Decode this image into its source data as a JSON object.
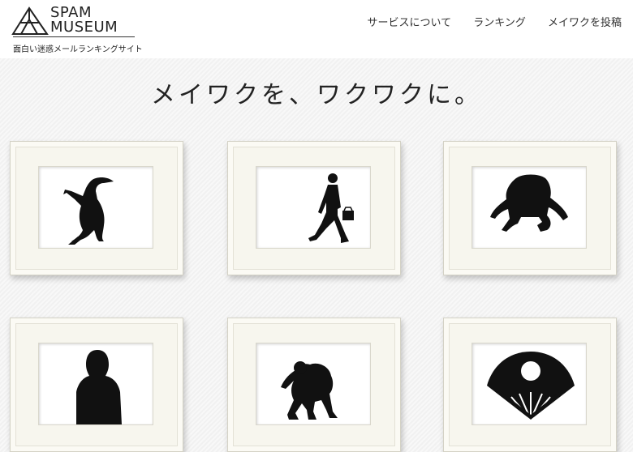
{
  "header": {
    "logo_line1": "SPAM",
    "logo_line2": "MUSEUM",
    "tagline": "面白い迷惑メールランキングサイト",
    "nav": [
      {
        "label": "サービスについて"
      },
      {
        "label": "ランキング"
      },
      {
        "label": "メイワクを投稿"
      }
    ]
  },
  "hero": {
    "title": "メイワクを、ワクワクに。"
  },
  "gallery": {
    "frames": [
      {
        "icon": "anteater-silhouette-icon"
      },
      {
        "icon": "walking-businessman-silhouette-icon"
      },
      {
        "icon": "kneeling-bow-silhouette-icon"
      },
      {
        "icon": "person-back-silhouette-icon"
      },
      {
        "icon": "ape-silhouette-icon"
      },
      {
        "icon": "folding-fan-silhouette-icon"
      }
    ]
  }
}
